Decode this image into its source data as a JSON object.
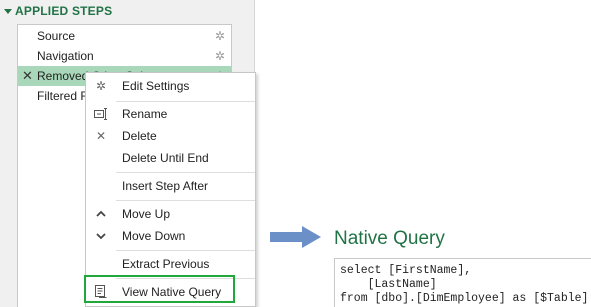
{
  "applied_steps": {
    "title": "APPLIED STEPS",
    "steps": [
      {
        "label": "Source"
      },
      {
        "label": "Navigation"
      },
      {
        "label": "Removed Other Columns"
      },
      {
        "label": "Filtered Rows"
      }
    ]
  },
  "context_menu": {
    "items": [
      {
        "label": "Edit Settings",
        "icon": "gear-icon"
      },
      {
        "label": "Rename",
        "icon": "rename-icon"
      },
      {
        "label": "Delete",
        "icon": "close-icon"
      },
      {
        "label": "Delete Until End",
        "icon": ""
      },
      {
        "label": "Insert Step After",
        "icon": ""
      },
      {
        "label": "Move Up",
        "icon": "chevron-up-icon"
      },
      {
        "label": "Move Down",
        "icon": "chevron-down-icon"
      },
      {
        "label": "Extract Previous",
        "icon": ""
      },
      {
        "label": "View Native Query",
        "icon": "document-icon"
      }
    ]
  },
  "native_query": {
    "title": "Native Query",
    "code_lines": [
      "select [FirstName],",
      "    [LastName]",
      "from [dbo].[DimEmployee] as [$Table]"
    ]
  },
  "colors": {
    "accent": "#217346",
    "active_step": "#a8d8b9",
    "highlight_border": "#22a83a",
    "arrow": "#6b8fc7"
  }
}
